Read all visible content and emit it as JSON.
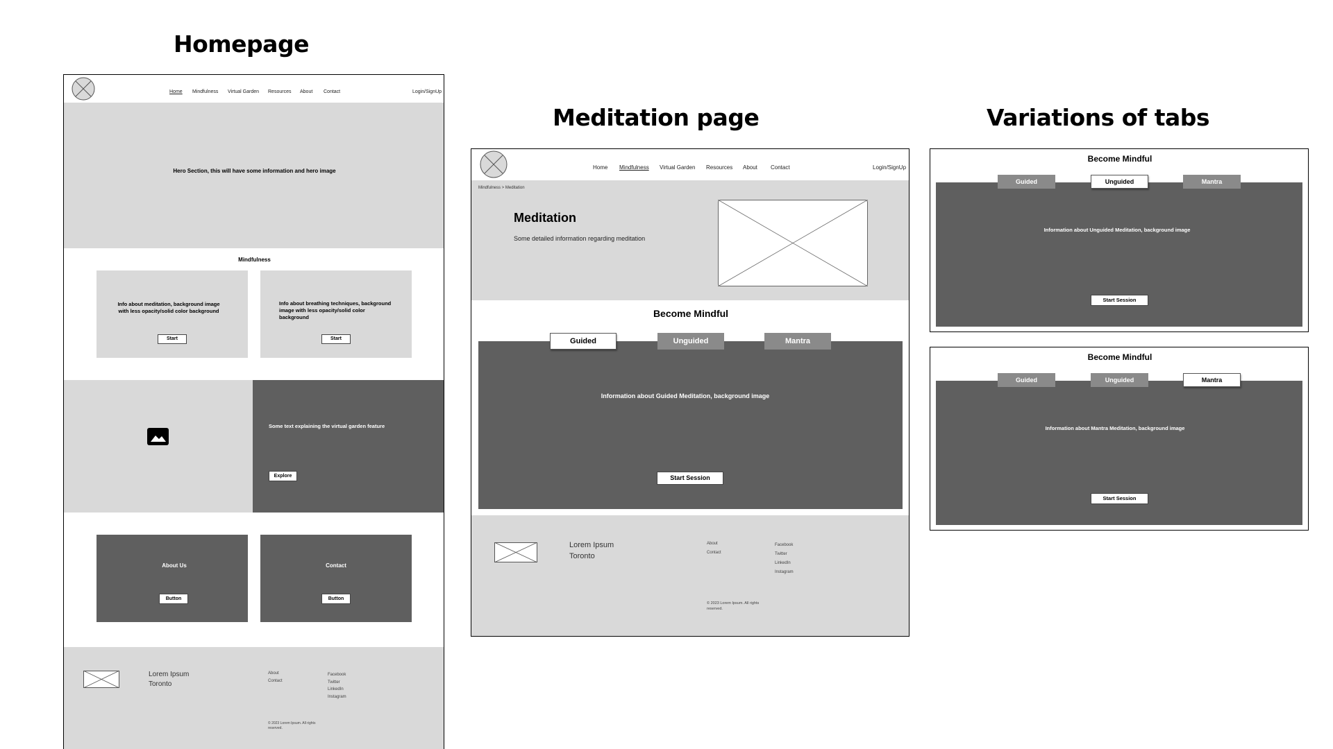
{
  "headings": {
    "homepage": "Homepage",
    "meditation": "Meditation page",
    "variations": "Variations of tabs"
  },
  "home": {
    "nav": {
      "links": [
        "Home",
        "Mindfulness",
        "Virtual Garden",
        "Resources",
        "About",
        "Contact"
      ],
      "active": "Home",
      "login": "Login/SignUp"
    },
    "hero_text": "Hero Section, this will have some information and hero image",
    "mindfulness": {
      "title": "Mindfulness",
      "card1_text": "Info about meditation, background image with less opacity/solid color background",
      "card2_text": "Info about breathing techniques, background image with less opacity/solid color background",
      "card1_button": "Start",
      "card2_button": "Start"
    },
    "garden": {
      "text": "Some text explaining the virtual garden feature",
      "button": "Explore",
      "image_icon": "image-icon"
    },
    "about_card": {
      "title": "About Us",
      "button": "Button"
    },
    "contact_card": {
      "title": "Contact",
      "button": "Button"
    },
    "footer": {
      "name": "Lorem Ipsum",
      "city": "Toronto",
      "links": [
        "About",
        "Contact"
      ],
      "social": [
        "Facebook",
        "Twitter",
        "LinkedIn",
        "Instagram"
      ],
      "copyright": "© 2023 Lorem Ipsum. All rights reserved."
    }
  },
  "meditation": {
    "nav": {
      "links": [
        "Home",
        "Mindfulness",
        "Virtual Garden",
        "Resources",
        "About",
        "Contact"
      ],
      "active": "Mindfulness",
      "login": "Login/SignUp"
    },
    "breadcrumb": "Mindfulness > Meditation",
    "hero_title": "Meditation",
    "hero_text": "Some detailed information regarding meditation",
    "section_title": "Become Mindful",
    "tabs": [
      "Guided",
      "Unguided",
      "Mantra"
    ],
    "active_tab": "Guided",
    "panel_text": "Information about Guided Meditation, background image",
    "start_button": "Start Session",
    "footer": {
      "name": "Lorem Ipsum",
      "city": "Toronto",
      "links": [
        "About",
        "Contact"
      ],
      "social": [
        "Facebook",
        "Twitter",
        "LinkedIn",
        "Instagram"
      ],
      "copyright": "© 2023 Lorem Ipsum. All rights reserved."
    }
  },
  "variations": [
    {
      "title": "Become Mindful",
      "tabs": [
        "Guided",
        "Unguided",
        "Mantra"
      ],
      "active_tab": "Unguided",
      "panel_text": "Information about Unguided Meditation, background image",
      "button": "Start Session"
    },
    {
      "title": "Become Mindful",
      "tabs": [
        "Guided",
        "Unguided",
        "Mantra"
      ],
      "active_tab": "Mantra",
      "panel_text": "Information about Mantra Meditation, background image",
      "button": "Start Session"
    }
  ],
  "colors": {
    "light_grey": "#d9d9d9",
    "dark_grey": "#5f5f5f",
    "inactive_tab": "#8a8a8a"
  }
}
